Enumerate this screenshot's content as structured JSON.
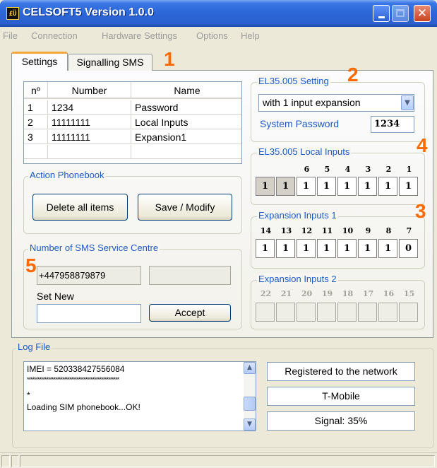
{
  "window": {
    "title": "CELSOFT5 Version 1.0.0",
    "icon": "celsoft-app-icon",
    "icon_text": "£Ü"
  },
  "menu": [
    "File",
    "Connection",
    "Hardware Settings",
    "Options",
    "Help"
  ],
  "tabs": [
    {
      "label": "Settings",
      "active": true
    },
    {
      "label": "Signalling SMS",
      "active": false
    }
  ],
  "markers": {
    "tabs": "1",
    "setting": "2",
    "expansion1": "3",
    "local_inputs": "4",
    "sms_centre": "5"
  },
  "phonebook": {
    "columns": [
      "nº",
      "Number",
      "Name"
    ],
    "rows": [
      {
        "n": "1",
        "number": "1234",
        "name": "Password"
      },
      {
        "n": "2",
        "number": "11111111",
        "name": "Local Inputs"
      },
      {
        "n": "3",
        "number": "11111111",
        "name": "Expansion1"
      }
    ]
  },
  "action_phonebook": {
    "label": "Action Phonebook",
    "delete_label": "Delete all items",
    "save_label": "Save / Modify"
  },
  "sms_centre": {
    "label": "Number of SMS Service Centre",
    "current": "+447958879879",
    "current_extra": "",
    "set_new_label": "Set New",
    "new_value": "",
    "accept_label": "Accept"
  },
  "el_setting": {
    "label": "EL35.005 Setting",
    "selected": "with 1 input expansion",
    "password_label": "System Password",
    "password_value": "1234"
  },
  "local_inputs": {
    "label": "EL35.005 Local Inputs",
    "headers": [
      "6",
      "5",
      "4",
      "3",
      "2",
      "1"
    ],
    "values": [
      "1",
      "1",
      "1",
      "1",
      "1",
      "1",
      "1",
      "1"
    ]
  },
  "expansion1": {
    "label": "Expansion Inputs 1",
    "headers": [
      "14",
      "13",
      "12",
      "11",
      "10",
      "9",
      "8",
      "7"
    ],
    "values": [
      "1",
      "1",
      "1",
      "1",
      "1",
      "1",
      "1",
      "0"
    ]
  },
  "expansion2": {
    "label": "Expansion Inputs 2",
    "headers": [
      "22",
      "21",
      "20",
      "19",
      "18",
      "17",
      "16",
      "15"
    ],
    "values": [
      "",
      "",
      "",
      "",
      "",
      "",
      "",
      ""
    ]
  },
  "log": {
    "label": "Log File",
    "lines": [
      "IMEI = 520338427556084",
      "****************************************************",
      "*",
      "Loading SIM phonebook...OK!"
    ],
    "status": "Registered to the network",
    "operator": "T-Mobile",
    "signal": "Signal: 35%"
  },
  "colors": {
    "accent": "#ff6a00",
    "group_label": "#1c5ac8",
    "titlebar": "#2c66d8"
  }
}
